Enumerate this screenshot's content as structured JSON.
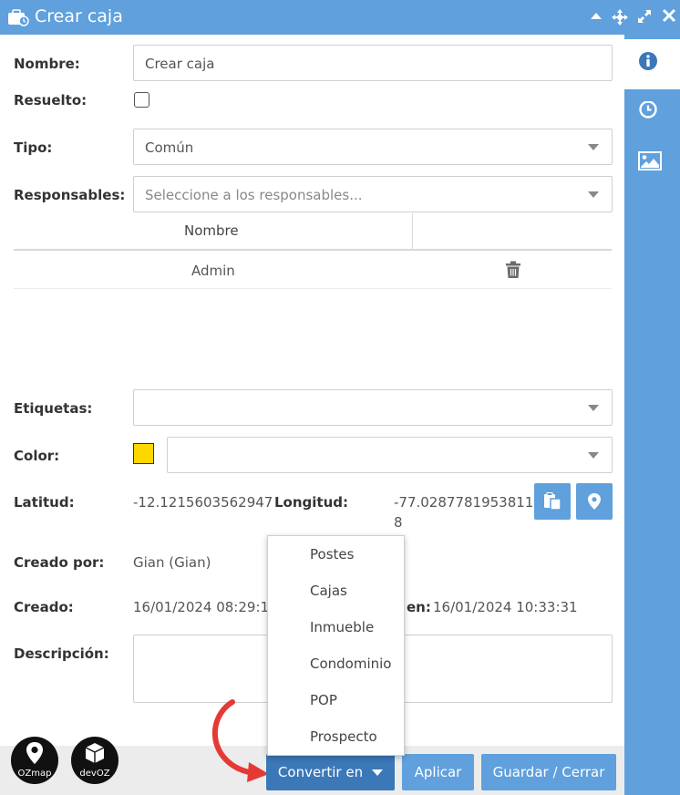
{
  "window": {
    "title": "Crear caja",
    "controls": [
      "collapse-icon",
      "move-icon",
      "expand-icon",
      "close-icon"
    ]
  },
  "sidebar_tabs": [
    {
      "icon": "info-icon",
      "active": true
    },
    {
      "icon": "clock-icon",
      "active": false
    },
    {
      "icon": "image-icon",
      "active": false
    }
  ],
  "form": {
    "nombre_label": "Nombre:",
    "nombre_value": "Crear caja",
    "resuelto_label": "Resuelto:",
    "resuelto_checked": false,
    "tipo_label": "Tipo:",
    "tipo_value": "Común",
    "responsables_label": "Responsables:",
    "responsables_placeholder": "Seleccione a los responsables...",
    "etiquetas_label": "Etiquetas:",
    "etiquetas_value": "",
    "color_label": "Color:",
    "color_value": "#ffd700",
    "latitud_label": "Latitud:",
    "latitud_value": "-12.1215603562947",
    "longitud_label": "Longitud:",
    "longitud_value_line1": "-77.0287781953811",
    "longitud_value_line2": "8",
    "creado_por_label": "Creado por:",
    "creado_por_value": "Gian (Gian)",
    "creado_label": "Creado:",
    "creado_value": "16/01/2024 08:29:16",
    "modificado_label_visible": "en:",
    "modificado_value": "16/01/2024 10:33:31",
    "descripcion_label": "Descripción:",
    "descripcion_value": ""
  },
  "responsables_table": {
    "columns": [
      "Nombre",
      ""
    ],
    "rows": [
      {
        "nombre": "Admin",
        "action_icon": "trash-icon"
      }
    ]
  },
  "location_buttons": [
    "paste-icon",
    "map-marker-icon"
  ],
  "logos": [
    {
      "text": "OZmap"
    },
    {
      "text": "devOZ"
    }
  ],
  "footer_buttons": {
    "convertir": "Convertir en",
    "aplicar": "Aplicar",
    "guardar": "Guardar / Cerrar"
  },
  "convertir_menu": [
    "Postes",
    "Cajas",
    "Inmueble",
    "Condominio",
    "POP",
    "Prospecto"
  ],
  "colors": {
    "accent": "#5fa0dd",
    "accent_dark": "#3b78b8",
    "annotation_arrow": "#e53935"
  }
}
